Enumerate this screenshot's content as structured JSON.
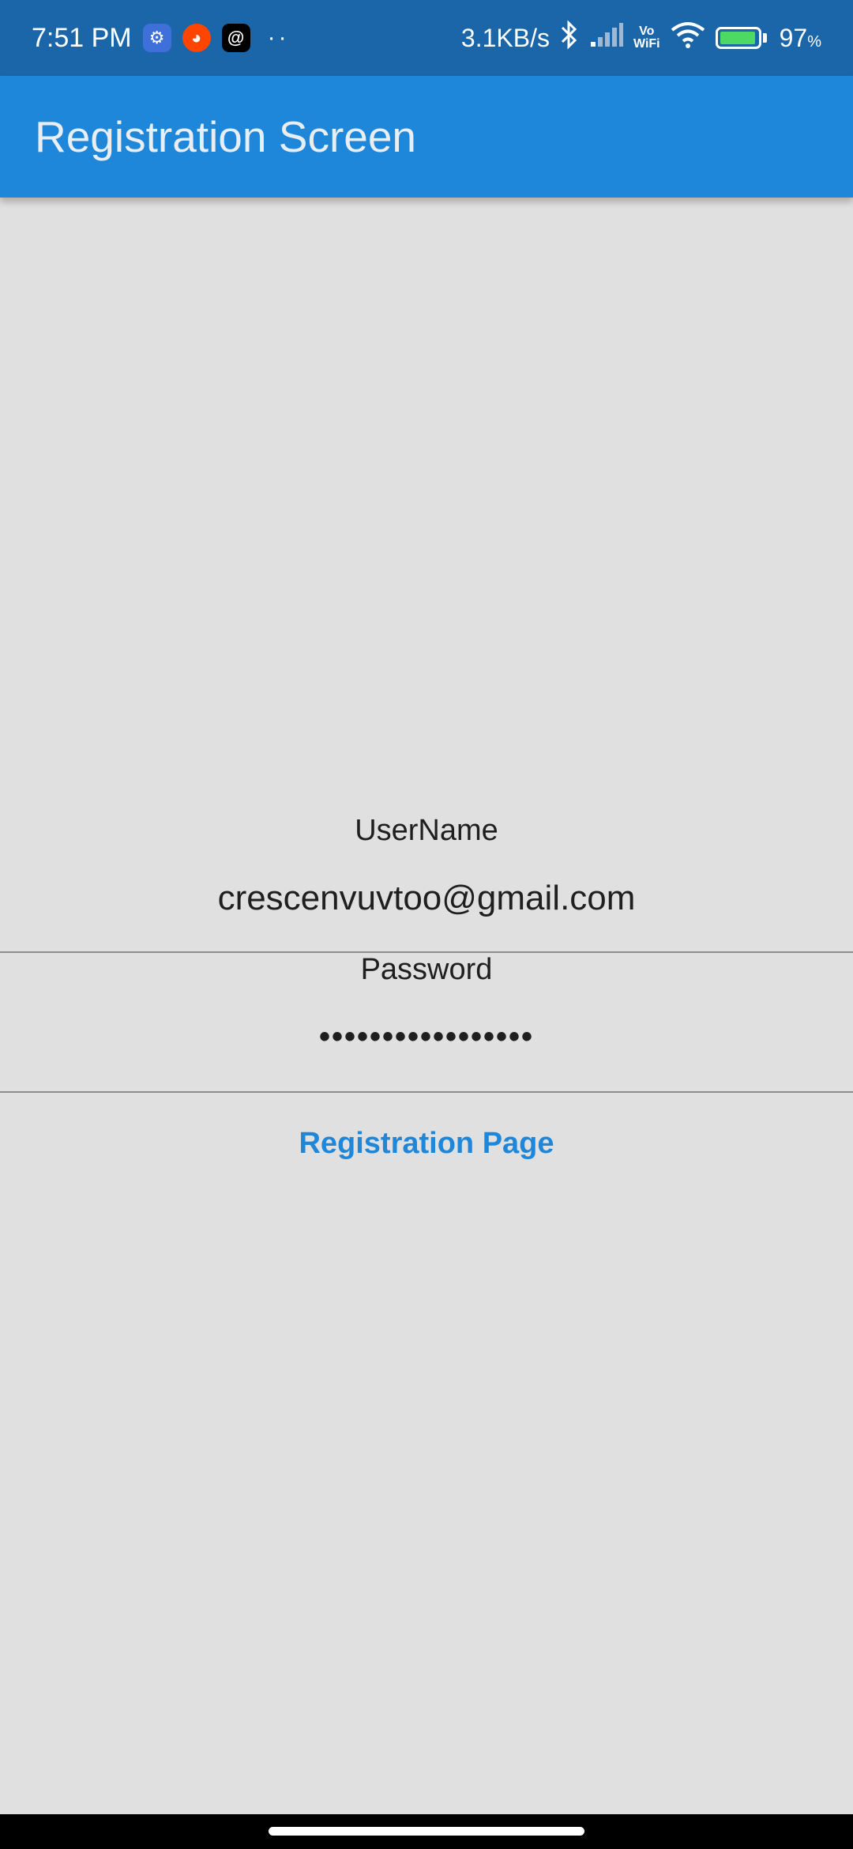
{
  "status_bar": {
    "time": "7:51 PM",
    "net_speed": "3.1KB/s",
    "vowifi_top": "Vo",
    "vowifi_bottom": "WiFi",
    "battery_percent": "97",
    "battery_unit": "%",
    "battery_level": 0.97,
    "overflow": "··",
    "icons": [
      "settings-app-icon",
      "reddit-icon",
      "threads-icon",
      "bluetooth-icon",
      "cell-signal-icon",
      "wifi-icon",
      "battery-charging-icon"
    ],
    "colors": {
      "background": "#1a66a8",
      "battery_fill": "#4cd964"
    }
  },
  "app_bar": {
    "title": "Registration Screen",
    "color": "#1e87d9"
  },
  "form": {
    "username_label": "UserName",
    "username_value": "crescenvuvtoo@gmail.com",
    "password_label": "Password",
    "password_value": "•••••••••••••••••",
    "registration_link": "Registration Page",
    "link_color": "#1e87d9"
  },
  "page": {
    "background": "#e0e0e0"
  }
}
